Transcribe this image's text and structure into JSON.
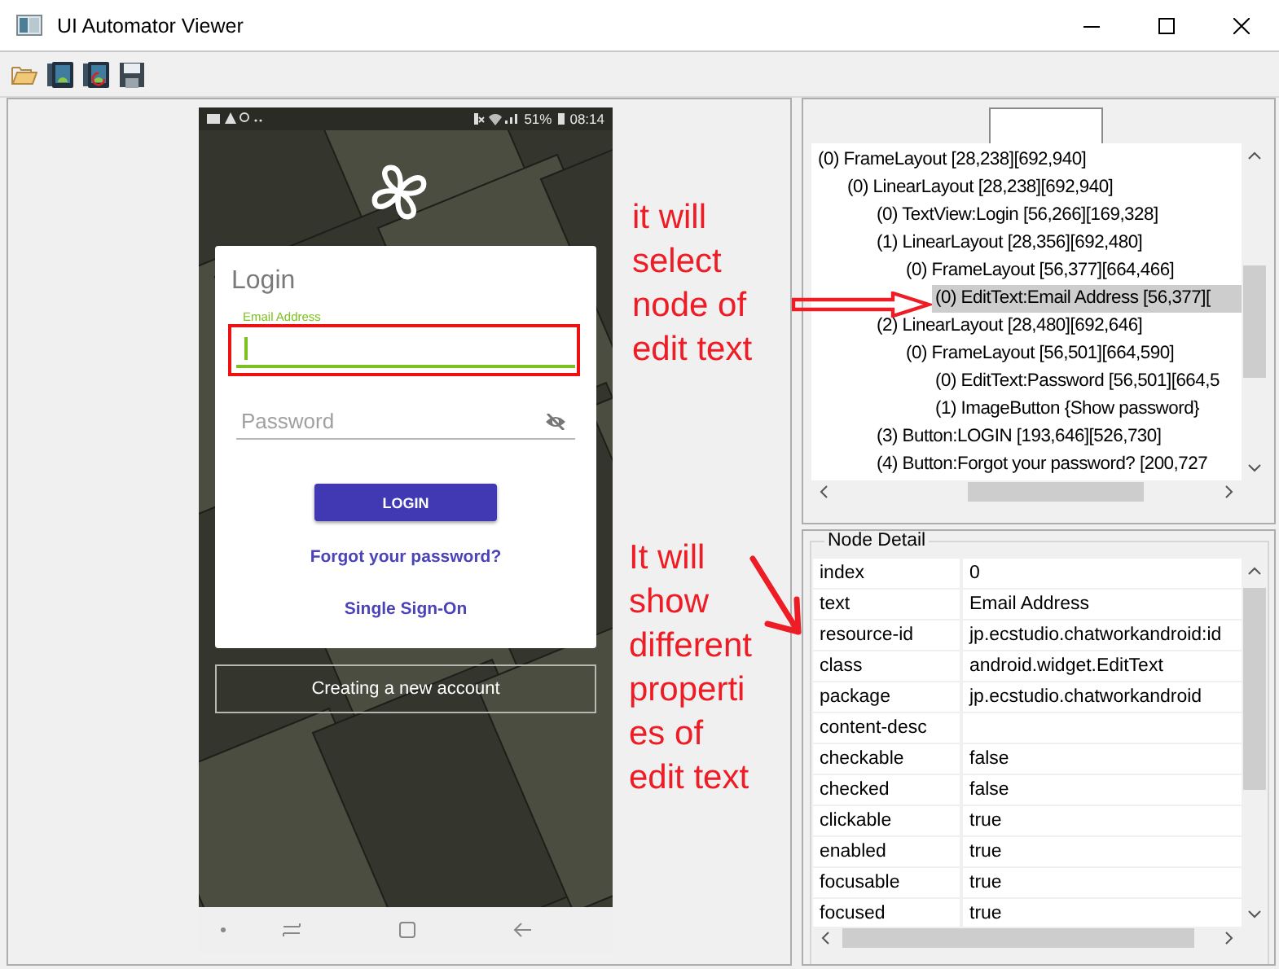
{
  "window": {
    "title": "UI Automator Viewer"
  },
  "phone": {
    "status_battery": "51%",
    "status_time": "08:14",
    "card_title": "Login",
    "email": {
      "label": "Email Address",
      "focused": true
    },
    "password": {
      "placeholder": "Password",
      "focused": false
    },
    "login_button": "LOGIN",
    "links": [
      "Forgot your password?",
      "Single Sign-On"
    ],
    "create_account_button": "Creating a new account"
  },
  "annotations": [
    {
      "lines": [
        "it will",
        "select",
        "node of",
        "edit text"
      ]
    },
    {
      "lines": [
        "It will",
        "show",
        "different",
        "properti",
        "es of",
        "edit text"
      ]
    }
  ],
  "tree": {
    "nodes": [
      {
        "label": "(0) FrameLayout [28,238][692,940]",
        "selected": false,
        "children": [
          {
            "label": "(0) LinearLayout [28,238][692,940]",
            "selected": false,
            "children": [
              {
                "label": "(0) TextView:Login [56,266][169,328]",
                "selected": false
              },
              {
                "label": "(1) LinearLayout [28,356][692,480]",
                "selected": false,
                "children": [
                  {
                    "label": "(0) FrameLayout [56,377][664,466]",
                    "selected": false,
                    "children": [
                      {
                        "label": "(0) EditText:Email Address [56,377][",
                        "selected": true
                      }
                    ]
                  }
                ]
              },
              {
                "label": "(2) LinearLayout [28,480][692,646]",
                "selected": false,
                "children": [
                  {
                    "label": "(0) FrameLayout [56,501][664,590]",
                    "selected": false,
                    "children": [
                      {
                        "label": "(0) EditText:Password [56,501][664,5",
                        "selected": false
                      },
                      {
                        "label": "(1) ImageButton {Show password}",
                        "selected": false
                      }
                    ]
                  }
                ]
              },
              {
                "label": "(3) Button:LOGIN [193,646][526,730]",
                "selected": false
              },
              {
                "label": "(4) Button:Forgot your password? [200,727",
                "selected": false
              }
            ]
          }
        ]
      }
    ]
  },
  "node_detail": {
    "title": "Node Detail",
    "rows": [
      {
        "key": "index",
        "value": "0"
      },
      {
        "key": "text",
        "value": "Email Address"
      },
      {
        "key": "resource-id",
        "value": "jp.ecstudio.chatworkandroid:id"
      },
      {
        "key": "class",
        "value": "android.widget.EditText"
      },
      {
        "key": "package",
        "value": "jp.ecstudio.chatworkandroid"
      },
      {
        "key": "content-desc"
      },
      {
        "key": "checkable",
        "value": "false"
      },
      {
        "key": "checked",
        "value": "false"
      },
      {
        "key": "clickable",
        "value": "true"
      },
      {
        "key": "enabled",
        "value": "true"
      },
      {
        "key": "focusable",
        "value": "true"
      },
      {
        "key": "focused",
        "value": "true"
      }
    ]
  }
}
